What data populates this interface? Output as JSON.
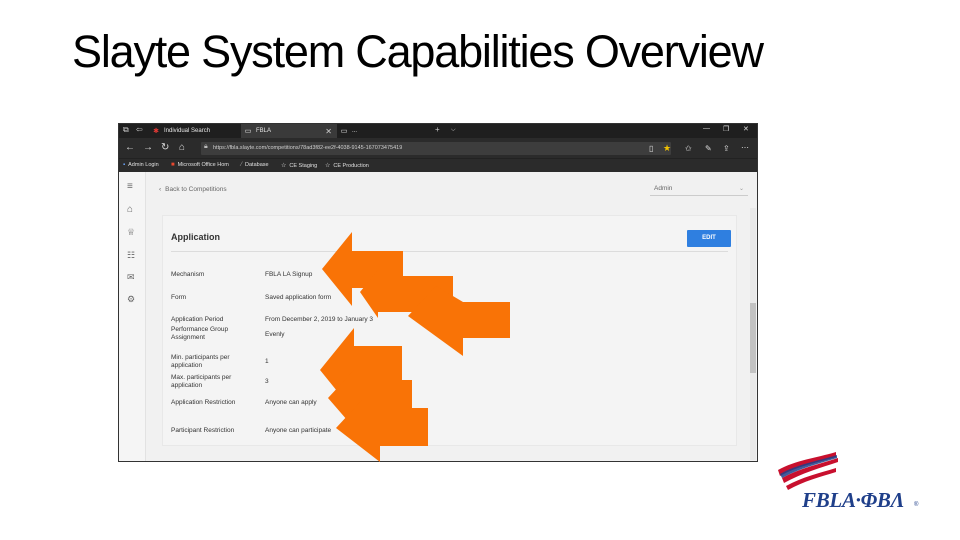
{
  "slide": {
    "title": "Slayte System Capabilities Overview"
  },
  "browser": {
    "tabs": [
      {
        "label": "Individual Search",
        "icon": "star-icon"
      },
      {
        "label": "FBLA",
        "icon": "page-icon"
      },
      {
        "label": "...",
        "icon": "page-icon"
      }
    ],
    "url": "https://fbla.slayte.com/competitions/78ad3f82-ee2f-4038-9145-167073475419",
    "favorites": [
      "Admin Login",
      "Microsoft Office Hom",
      "Database",
      "CE Staging",
      "CE Production"
    ]
  },
  "app": {
    "back_link": "Back to Competitions",
    "role": "Admin",
    "card_title": "Application",
    "edit_label": "EDIT",
    "fields": [
      {
        "label": "Mechanism",
        "value": "FBLA LA Signup"
      },
      {
        "label": "Form",
        "value": "Saved application form"
      },
      {
        "label": "Application Period",
        "value": "From December 2, 2019 to January 3"
      },
      {
        "label": "Performance Group Assignment",
        "value": "Evenly"
      },
      {
        "label": "Min. participants per application",
        "value": "1"
      },
      {
        "label": "Max. participants per application",
        "value": "3"
      },
      {
        "label": "Application Restriction",
        "value": "Anyone can apply"
      },
      {
        "label": "Participant Restriction",
        "value": "Anyone can participate"
      }
    ]
  },
  "colors": {
    "arrow": "#f97306",
    "edit_button": "#2f7fe0",
    "logo_blue": "#1f3f8a",
    "logo_red": "#c8102e"
  },
  "logo": {
    "text": "FBLA·ΦΒΛ"
  }
}
